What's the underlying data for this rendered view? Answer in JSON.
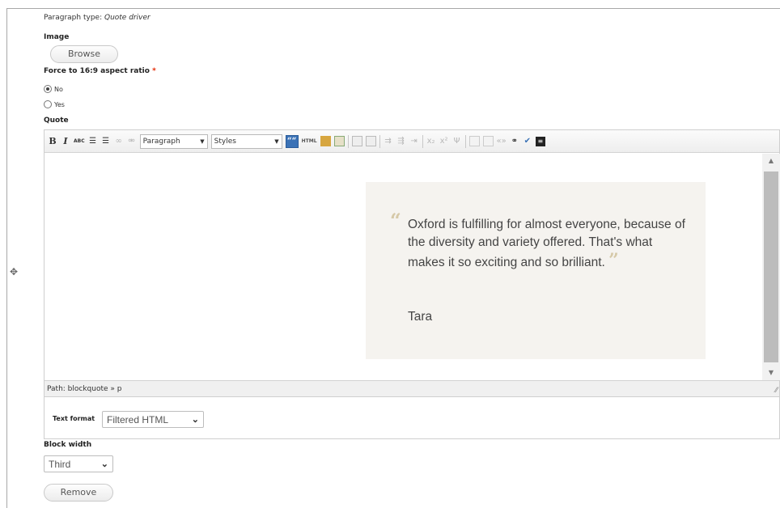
{
  "paragraph_type": {
    "label": "Paragraph type:",
    "value": "Quote driver"
  },
  "image": {
    "label": "Image",
    "browse_label": "Browse"
  },
  "aspect_ratio": {
    "label": "Force to 16:9 aspect ratio",
    "required_mark": "*",
    "options": [
      {
        "label": "No",
        "checked": true
      },
      {
        "label": "Yes",
        "checked": false
      }
    ]
  },
  "quote": {
    "label": "Quote",
    "toolbar": {
      "bold": "B",
      "italic": "I",
      "strike": "ABC",
      "format_select": "Paragraph",
      "styles_select": "Styles",
      "blockquote": "““",
      "html": "HTML"
    },
    "content": {
      "quote_text": "Oxford is fulfilling for almost everyone, because of the diversity and variety offered. That's what makes it so exciting and so brilliant.",
      "author": "Tara"
    },
    "path": "Path: blockquote » p"
  },
  "text_format": {
    "label": "Text format",
    "value": "Filtered HTML"
  },
  "block_width": {
    "label": "Block width",
    "value": "Third"
  },
  "remove_label": "Remove",
  "icons": {
    "drag": "drag-handle-icon",
    "quote_open": "“",
    "quote_close": "”"
  }
}
